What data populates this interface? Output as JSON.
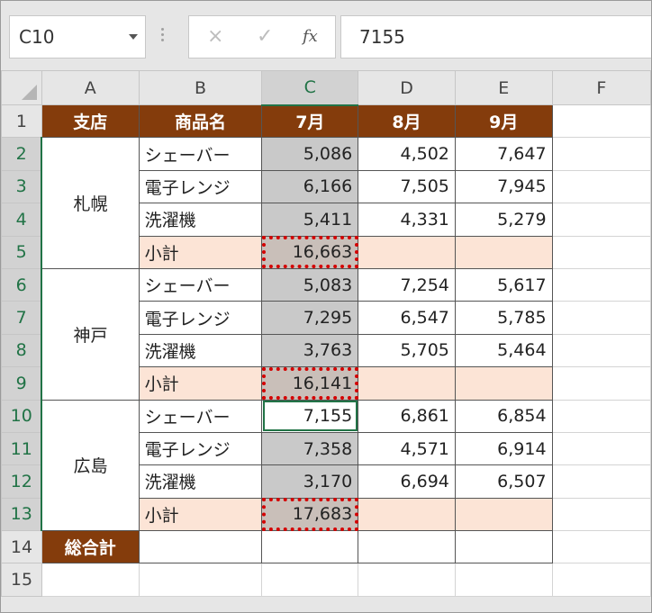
{
  "name_box": {
    "value": "C10"
  },
  "formula_bar": {
    "cancel_icon": "×",
    "enter_icon": "✓",
    "fx_label": "fx",
    "value": "7155"
  },
  "columns": [
    "A",
    "B",
    "C",
    "D",
    "E",
    "F"
  ],
  "rows": [
    "1",
    "2",
    "3",
    "4",
    "5",
    "6",
    "7",
    "8",
    "9",
    "10",
    "11",
    "12",
    "13",
    "14",
    "15"
  ],
  "header": {
    "branch": "支店",
    "product": "商品名",
    "jul": "7月",
    "aug": "8月",
    "sep": "9月"
  },
  "branches": [
    "札幌",
    "神戸",
    "広島"
  ],
  "data": [
    {
      "product": "シェーバー",
      "jul": "5,086",
      "aug": "4,502",
      "sep": "7,647"
    },
    {
      "product": "電子レンジ",
      "jul": "6,166",
      "aug": "7,505",
      "sep": "7,945"
    },
    {
      "product": "洗濯機",
      "jul": "5,411",
      "aug": "4,331",
      "sep": "5,279"
    },
    {
      "product": "小計",
      "jul": "16,663",
      "aug": "",
      "sep": ""
    },
    {
      "product": "シェーバー",
      "jul": "5,083",
      "aug": "7,254",
      "sep": "5,617"
    },
    {
      "product": "電子レンジ",
      "jul": "7,295",
      "aug": "6,547",
      "sep": "5,785"
    },
    {
      "product": "洗濯機",
      "jul": "3,763",
      "aug": "5,705",
      "sep": "5,464"
    },
    {
      "product": "小計",
      "jul": "16,141",
      "aug": "",
      "sep": ""
    },
    {
      "product": "シェーバー",
      "jul": "7,155",
      "aug": "6,861",
      "sep": "6,854"
    },
    {
      "product": "電子レンジ",
      "jul": "7,358",
      "aug": "4,571",
      "sep": "6,914"
    },
    {
      "product": "洗濯機",
      "jul": "3,170",
      "aug": "6,694",
      "sep": "6,507"
    },
    {
      "product": "小計",
      "jul": "17,683",
      "aug": "",
      "sep": ""
    }
  ],
  "grand_total_label": "総合計",
  "colors": {
    "header_fill": "#843c0c",
    "subtotal_fill": "#fce4d6",
    "selection_fill": "#c9c9c9",
    "marker": "#d40000",
    "excel_green": "#217346"
  }
}
